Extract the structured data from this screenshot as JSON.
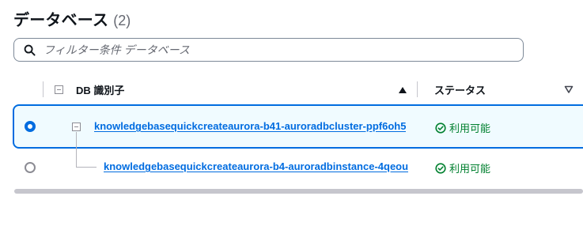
{
  "header": {
    "title": "データベース",
    "count": "(2)"
  },
  "search": {
    "placeholder": "フィルター条件 データベース",
    "value": "",
    "icon": "search-icon"
  },
  "table": {
    "columns": [
      {
        "label": "DB 識別子",
        "sort": "ascending"
      },
      {
        "label": "ステータス",
        "sort": "none"
      }
    ],
    "rows": [
      {
        "selected": true,
        "identifier": "knowledgebasequickcreateaurora-b41-auroradbcluster-ppf6oh5",
        "status": "利用可能",
        "level": 0,
        "expandable": true
      },
      {
        "selected": false,
        "identifier": "knowledgebasequickcreateaurora-b4-auroradbinstance-4qeou",
        "status": "利用可能",
        "level": 1,
        "expandable": false
      }
    ]
  },
  "colors": {
    "accent": "#006ce0",
    "selected_row_bg": "#f0fbff",
    "status_ok": "#00802f"
  }
}
